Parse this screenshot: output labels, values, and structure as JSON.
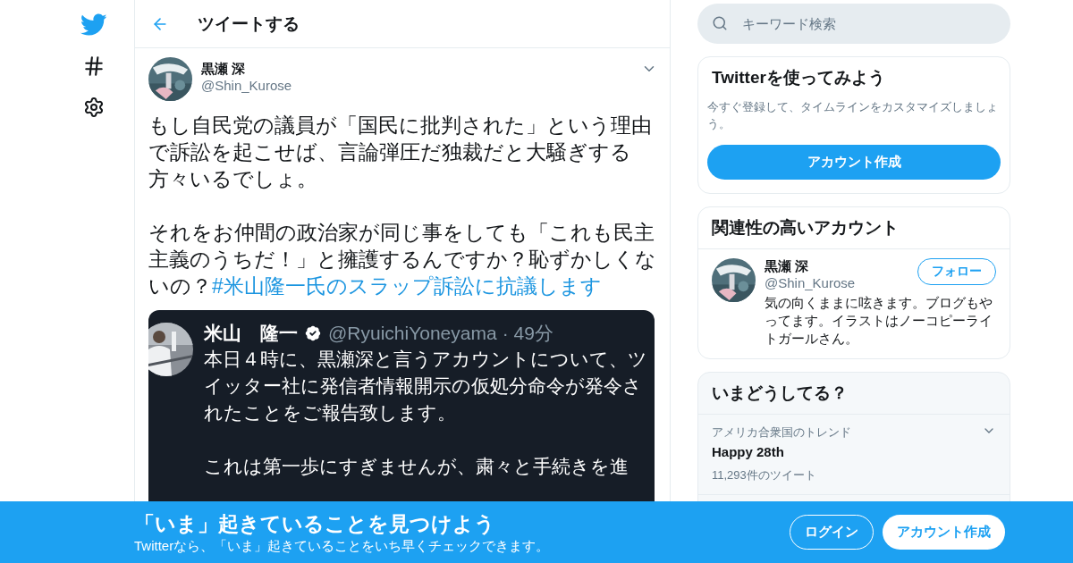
{
  "header": {
    "title": "ツイートする"
  },
  "tweet": {
    "name": "黒瀬 深",
    "handle": "@Shin_Kurose",
    "paragraphs": [
      {
        "text": "もし自民党の議員が「国民に批判された」という理由で訴訟を起こせば、言論弾圧だ独裁だと大騒ぎする方々いるでしょ。"
      },
      {
        "text": "それをお仲間の政治家が同じ事をしても「これも民主主義のうちだ！」と擁護するんですか？恥ずかしくないの？",
        "hashtag": "#米山隆一氏のスラップ訴訟に抗議します"
      }
    ],
    "embedded": {
      "name": "米山　隆一",
      "handle": "@RyuichiYoneyama",
      "time": "· 49分",
      "paragraphs": [
        "本日４時に、黒瀬深と言うアカウントについて、ツイッター社に発信者情報開示の仮処分命令が発令されたことをご報告致します。",
        "これは第一歩にすぎませんが、粛々と手続きを進"
      ]
    }
  },
  "search": {
    "placeholder": "キーワード検索"
  },
  "signup_card": {
    "title": "Twitterを使ってみよう",
    "text": "今すぐ登録して、タイムラインをカスタマイズしましょう。",
    "button": "アカウント作成"
  },
  "related": {
    "title": "関連性の高いアカウント",
    "accounts": [
      {
        "name": "黒瀬 深",
        "handle": "@Shin_Kurose",
        "bio": "気の向くままに呟きます。ブログもやってます。イラストはノーコピーライトガールさん。",
        "button": "フォロー"
      }
    ]
  },
  "trends": {
    "title": "いまどうしてる？",
    "items": [
      {
        "context": "アメリカ合衆国のトレンド",
        "name": "Happy 28th",
        "count": "11,293件のツイート"
      }
    ]
  },
  "banner": {
    "title": "「いま」起きていることを見つけよう",
    "subtitle": "Twitterなら、「いま」起きていることをいち早くチェックできます。",
    "login": "ログイン",
    "signup": "アカウント作成"
  }
}
